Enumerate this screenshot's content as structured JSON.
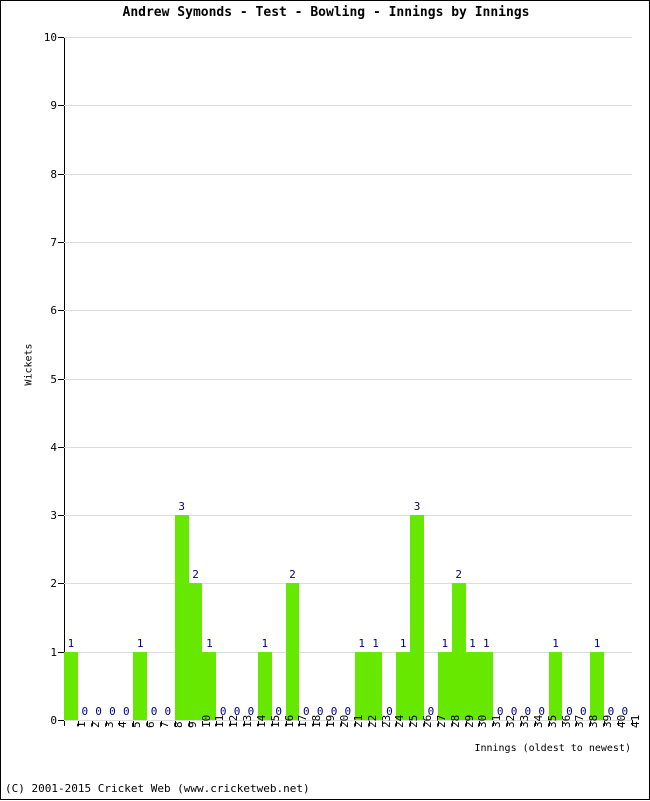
{
  "chart_data": {
    "type": "bar",
    "title": "Andrew Symonds - Test - Bowling - Innings by Innings",
    "xlabel": "Innings (oldest to newest)",
    "ylabel": "Wickets",
    "ylim": [
      0,
      10
    ],
    "ytick_labels": [
      "0",
      "1",
      "2",
      "3",
      "4",
      "5",
      "6",
      "7",
      "8",
      "9",
      "10"
    ],
    "grid": true,
    "legend": null,
    "bar_color": "#66e800",
    "label_color": "#00008b",
    "categories": [
      "1",
      "2",
      "3",
      "4",
      "5",
      "6",
      "7",
      "8",
      "9",
      "10",
      "11",
      "12",
      "13",
      "14",
      "15",
      "16",
      "17",
      "18",
      "19",
      "20",
      "21",
      "22",
      "23",
      "24",
      "25",
      "26",
      "27",
      "28",
      "29",
      "30",
      "31",
      "32",
      "33",
      "34",
      "35",
      "36",
      "37",
      "38",
      "39",
      "40",
      "41"
    ],
    "values": [
      1,
      0,
      0,
      0,
      0,
      1,
      0,
      0,
      3,
      2,
      1,
      0,
      0,
      0,
      1,
      0,
      2,
      0,
      0,
      0,
      0,
      1,
      1,
      0,
      1,
      3,
      0,
      1,
      2,
      1,
      1,
      0,
      0,
      0,
      0,
      1,
      0,
      0,
      1,
      0,
      0
    ]
  },
  "footer": {
    "copyright": "(C) 2001-2015 Cricket Web (www.cricketweb.net)"
  }
}
